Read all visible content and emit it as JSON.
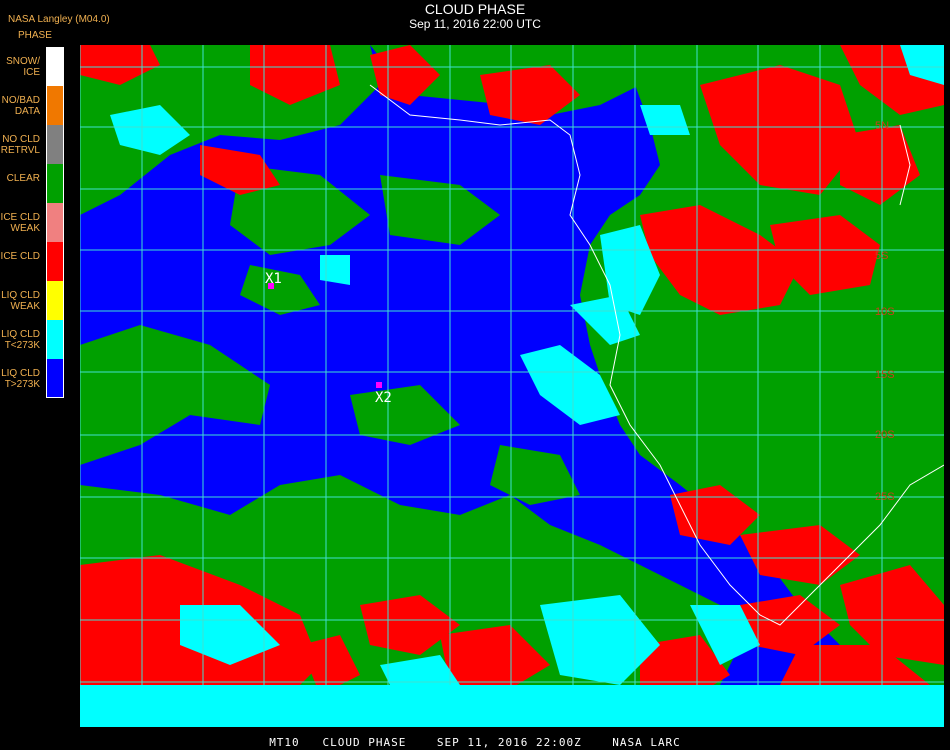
{
  "header": {
    "source": "NASA Langley (M04.0)",
    "product": "PHASE",
    "title": "CLOUD PHASE",
    "subtitle": "Sep 11, 2016 22:00 UTC"
  },
  "legend": [
    {
      "label": "SNOW/\nICE",
      "color": "#ffffff"
    },
    {
      "label": "NO/BAD\nDATA",
      "color": "#f07800"
    },
    {
      "label": "NO CLD\nRETRVL",
      "color": "#808080"
    },
    {
      "label": "CLEAR",
      "color": "#00a000"
    },
    {
      "label": "ICE CLD\nWEAK",
      "color": "#f08080"
    },
    {
      "label": "ICE CLD",
      "color": "#ff0000"
    },
    {
      "label": "LIQ CLD\nWEAK",
      "color": "#ffff00"
    },
    {
      "label": "LIQ CLD\nT<273K",
      "color": "#00ffff"
    },
    {
      "label": "LIQ CLD\nT>273K",
      "color": "#0000ff"
    }
  ],
  "map": {
    "lat_labels": [
      "5N",
      "5S",
      "10S",
      "15S",
      "20S",
      "25S"
    ],
    "markers": [
      "X1",
      "X2"
    ],
    "colors": {
      "water_cloud": "#0000ff",
      "clear": "#00a000",
      "ice": "#ff0000",
      "cold_liquid": "#00ffff",
      "grid": "#40e0d0"
    }
  },
  "footer": "MT10   CLOUD PHASE    SEP 11, 2016 22:00Z    NASA LARC"
}
